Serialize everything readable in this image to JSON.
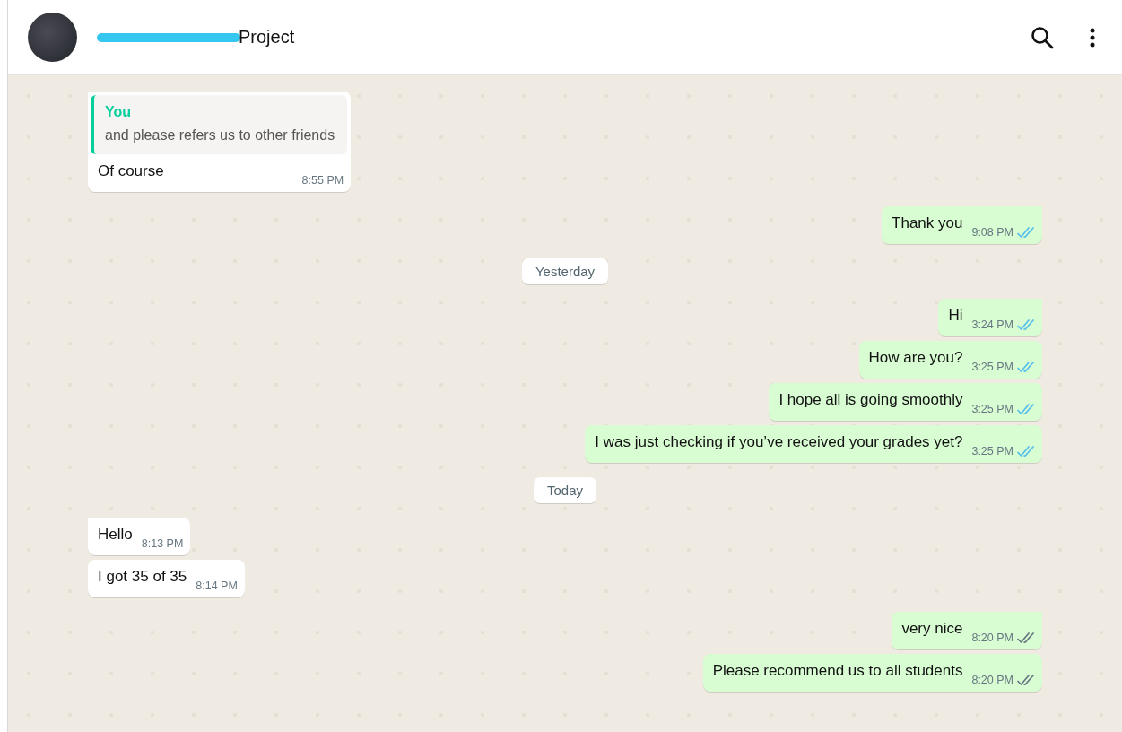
{
  "header": {
    "title": "Project"
  },
  "messages": [
    {
      "kind": "received",
      "tail": true,
      "quote": {
        "author": "You",
        "text": "and please refers us to other friends"
      },
      "text": "Of course",
      "time": "8:55 PM"
    },
    {
      "kind": "sent",
      "tail": true,
      "text": "Thank you",
      "time": "9:08 PM",
      "read": true
    },
    {
      "kind": "date",
      "label": "Yesterday"
    },
    {
      "kind": "sent",
      "tail": true,
      "text": "Hi",
      "time": "3:24 PM",
      "read": true
    },
    {
      "kind": "sent",
      "tail": false,
      "text": "How are you?",
      "time": "3:25 PM",
      "read": true
    },
    {
      "kind": "sent",
      "tail": false,
      "text": "I hope all is going smoothly",
      "time": "3:25 PM",
      "read": true
    },
    {
      "kind": "sent",
      "tail": false,
      "text": "I was just checking if you’ve received your grades yet?",
      "time": "3:25 PM",
      "read": true
    },
    {
      "kind": "date",
      "label": "Today"
    },
    {
      "kind": "received",
      "tail": true,
      "text": "Hello",
      "time": "8:13 PM"
    },
    {
      "kind": "received",
      "tail": false,
      "text": "I got 35 of 35",
      "time": "8:14 PM"
    },
    {
      "kind": "sent",
      "tail": true,
      "text": "very nice",
      "time": "8:20 PM",
      "read": false
    },
    {
      "kind": "sent",
      "tail": false,
      "text": "Please recommend us to all students",
      "time": "8:20 PM",
      "read": false
    }
  ]
}
